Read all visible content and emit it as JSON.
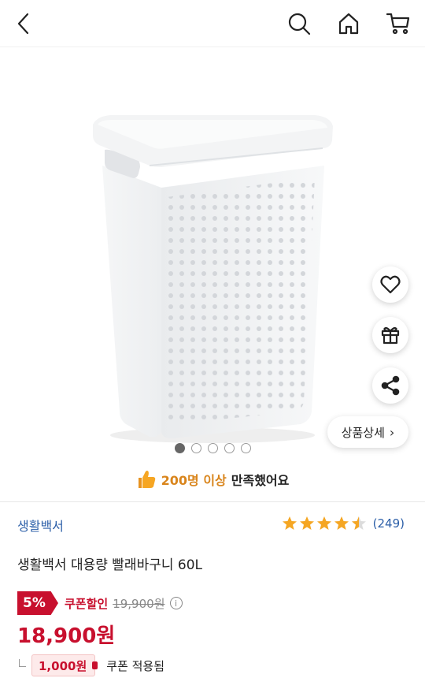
{
  "header": {
    "back_icon": "chevron-left-icon",
    "search_icon": "search-icon",
    "home_icon": "home-icon",
    "cart_icon": "cart-icon"
  },
  "gallery": {
    "product_image": "white-perforated-laundry-basket",
    "slide_count": 5,
    "active_slide": 0,
    "detail_button": "상품상세",
    "side_actions": [
      "heart-icon",
      "gift-icon",
      "share-icon"
    ]
  },
  "satisfaction": {
    "icon": "thumbs-up-icon",
    "count_text": "200명 이상",
    "rest_text": "만족했어요"
  },
  "product": {
    "brand": "생활백서",
    "rating_value": 4.5,
    "review_count": "(249)",
    "title": "생활백서 대용량 빨래바구니 60L"
  },
  "pricing": {
    "discount_rate": "5%",
    "coupon_label": "쿠폰할인",
    "original_price": "19,900원",
    "info_icon": "ⓘ",
    "sale_price": "18,900원",
    "coupon_amount": "1,000원",
    "coupon_applied": "쿠폰 적용됨"
  },
  "colors": {
    "accent_red": "#c8102e",
    "brand_blue": "#2c5fa8",
    "star_gold": "#f5a623",
    "highlight_orange": "#d9851c"
  }
}
